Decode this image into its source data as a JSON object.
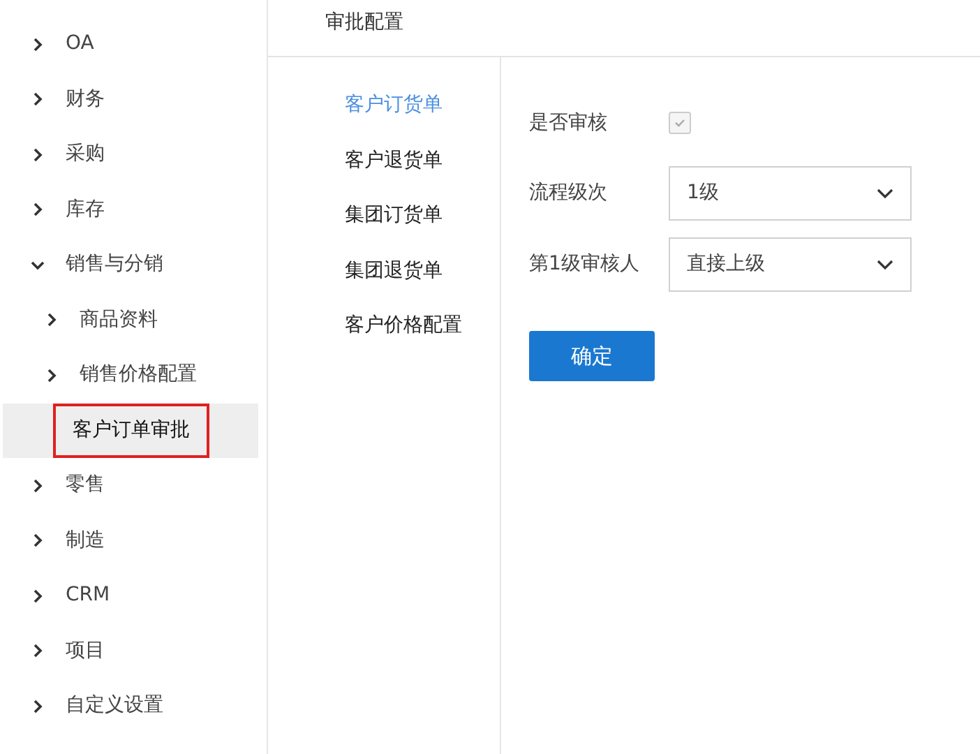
{
  "sidebar": {
    "items": [
      {
        "label": "OA",
        "kind": "group",
        "expanded": false,
        "selected": false
      },
      {
        "label": "财务",
        "kind": "group",
        "expanded": false,
        "selected": false
      },
      {
        "label": "采购",
        "kind": "group",
        "expanded": false,
        "selected": false
      },
      {
        "label": "库存",
        "kind": "group",
        "expanded": false,
        "selected": false
      },
      {
        "label": "销售与分销",
        "kind": "group",
        "expanded": true,
        "selected": false,
        "children": [
          {
            "label": "商品资料",
            "kind": "group",
            "expanded": false,
            "selected": false
          },
          {
            "label": "销售价格配置",
            "kind": "group",
            "expanded": false,
            "selected": false
          },
          {
            "label": "客户订单审批",
            "kind": "leaf",
            "selected": true,
            "marked": true
          }
        ]
      },
      {
        "label": "零售",
        "kind": "group",
        "expanded": false,
        "selected": false
      },
      {
        "label": "制造",
        "kind": "group",
        "expanded": false,
        "selected": false
      },
      {
        "label": "CRM",
        "kind": "group",
        "expanded": false,
        "selected": false
      },
      {
        "label": "项目",
        "kind": "group",
        "expanded": false,
        "selected": false
      },
      {
        "label": "自定义设置",
        "kind": "group",
        "expanded": false,
        "selected": false
      }
    ]
  },
  "header": {
    "title": "审批配置"
  },
  "subnav": [
    {
      "label": "客户订货单",
      "selected": true
    },
    {
      "label": "客户退货单",
      "selected": false
    },
    {
      "label": "集团订货单",
      "selected": false
    },
    {
      "label": "集团退货单",
      "selected": false
    },
    {
      "label": "客户价格配置",
      "selected": false
    }
  ],
  "form": {
    "fields": [
      {
        "label": "是否审核",
        "kind": "checkbox",
        "checked": true,
        "disabled": true
      },
      {
        "label": "流程级次",
        "kind": "select",
        "value": "1级"
      },
      {
        "label": "第1级审核人",
        "kind": "select",
        "value": "直接上级"
      }
    ],
    "submit": "确定"
  }
}
